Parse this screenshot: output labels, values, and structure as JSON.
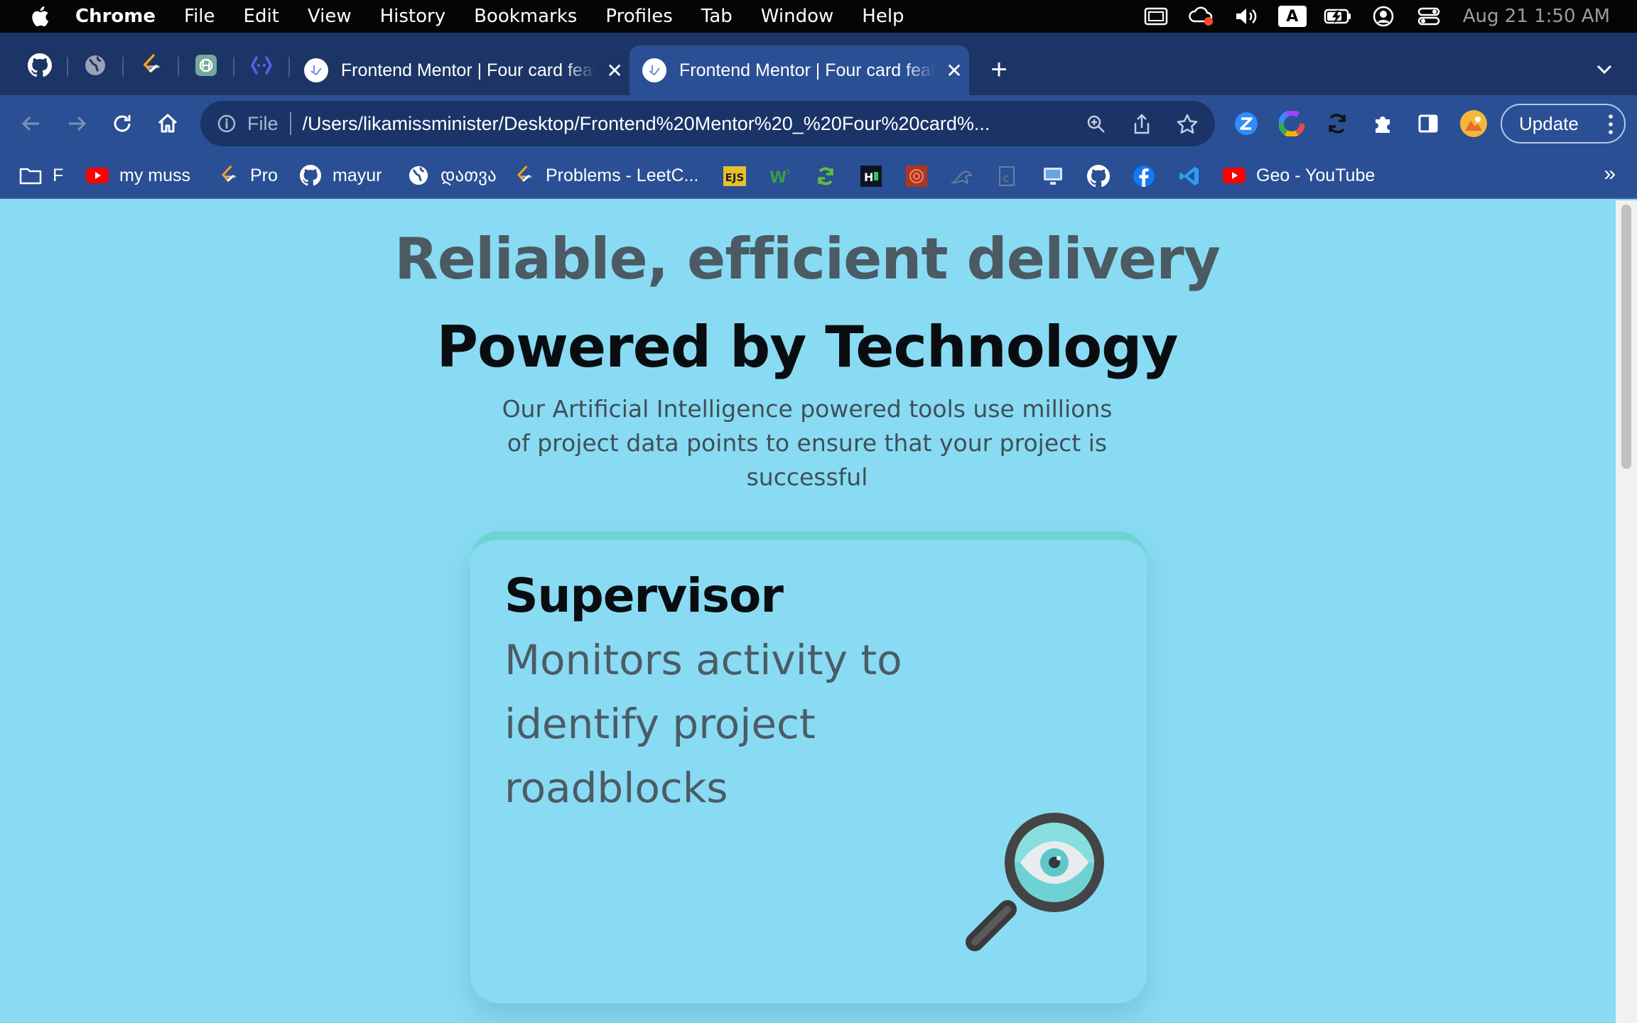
{
  "menubar": {
    "app_name": "Chrome",
    "items": [
      "File",
      "Edit",
      "View",
      "History",
      "Bookmarks",
      "Profiles",
      "Tab",
      "Window",
      "Help"
    ],
    "input_source": "A",
    "clock": "Aug 21  1:50 AM"
  },
  "tabs": {
    "pinned": [
      "github-icon",
      "globe-icon",
      "leetcode-icon",
      "chatgpt-icon",
      "codepen-icon"
    ],
    "open": [
      {
        "title": "Frontend Mentor | Four card feature section",
        "active": false
      },
      {
        "title": "Frontend Mentor | Four card feature section",
        "active": true
      }
    ]
  },
  "toolbar": {
    "scheme": "File",
    "url": "/Users/likamissminister/Desktop/Frontend%20Mentor%20_%20Four%20card%...",
    "update_label": "Update"
  },
  "bookmarks": [
    {
      "label": "F",
      "icon": "folder-icon"
    },
    {
      "label": "my muss",
      "icon": "youtube-icon"
    },
    {
      "label": "Pro",
      "icon": "leetcode-icon"
    },
    {
      "label": "mayur",
      "icon": "github-icon"
    },
    {
      "label": "დათვა",
      "icon": "globe-icon"
    },
    {
      "label": "Problems - LeetC...",
      "icon": "leetcode-icon"
    },
    {
      "label": "Geo - YouTube",
      "icon": "youtube-icon"
    }
  ],
  "bookmark_more": "»",
  "page": {
    "subtitle": "Reliable, efficient delivery",
    "title": "Powered by Technology",
    "description": "Our Artificial Intelligence powered tools use millions of project data points to ensure that your project is successful",
    "card": {
      "title": "Supervisor",
      "text": "Monitors activity to identify project roadblocks",
      "icon": "supervisor-magnifier-icon",
      "accent": "#6fd2d2"
    }
  },
  "colors": {
    "page_bg": "#89dbf3",
    "chrome_frame": "#1c3566",
    "chrome_toolbar": "#2a4f94"
  }
}
